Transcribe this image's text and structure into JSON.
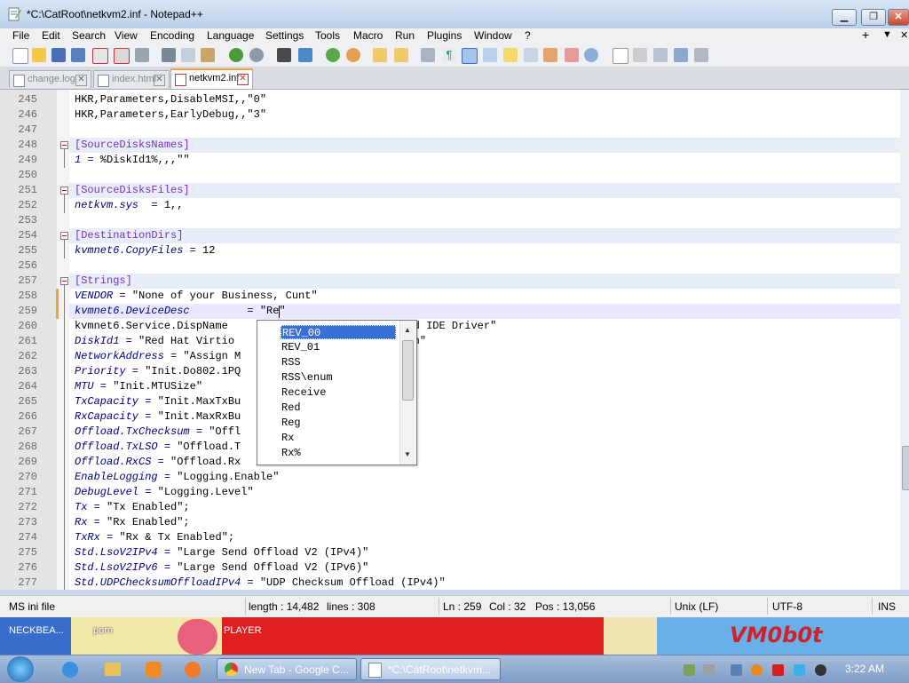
{
  "window": {
    "title": "*C:\\CatRoot\\netkvm2.inf - Notepad++",
    "min_label": "▁",
    "max_label": "❐",
    "close_label": "✕"
  },
  "menu": {
    "items": [
      "File",
      "Edit",
      "Search",
      "View",
      "Encoding",
      "Language",
      "Settings",
      "Tools",
      "Macro",
      "Run",
      "Plugins",
      "Window",
      "?"
    ],
    "right": [
      "+",
      "▼",
      "✕"
    ]
  },
  "tabs": [
    {
      "label": "change.log",
      "active": false
    },
    {
      "label": "index.html",
      "active": false
    },
    {
      "label": "netkvm2.inf",
      "active": true
    }
  ],
  "editor": {
    "lines": [
      {
        "n": "245",
        "text": "HKR,Parameters,DisableMSI,,\"0\""
      },
      {
        "n": "246",
        "text": "HKR,Parameters,EarlyDebug,,\"3\""
      },
      {
        "n": "247",
        "text": ""
      },
      {
        "n": "248",
        "text": "[SourceDisksNames]"
      },
      {
        "n": "249",
        "text": "1 = %DiskId1%,,,\"\""
      },
      {
        "n": "250",
        "text": ""
      },
      {
        "n": "251",
        "text": "[SourceDisksFiles]"
      },
      {
        "n": "252",
        "text": "netkvm.sys  = 1,,"
      },
      {
        "n": "253",
        "text": ""
      },
      {
        "n": "254",
        "text": "[DestinationDirs]"
      },
      {
        "n": "255",
        "text": "kvmnet6.CopyFiles = 12"
      },
      {
        "n": "256",
        "text": ""
      },
      {
        "n": "257",
        "text": "[Strings]"
      },
      {
        "n": "258",
        "text": "VENDOR = \"None of your Business, Cunt\""
      },
      {
        "n": "259",
        "text": "kvmnet6.DeviceDesc         = \"Re\""
      },
      {
        "n": "260",
        "text": "kvmnet6.Service.DispName                        tended IDE Driver\""
      },
      {
        "n": "261",
        "text": "DiskId1 = \"Red Hat Virtio                      mba Wan\""
      },
      {
        "n": "262",
        "text": "NetworkAddress = \"Assign M"
      },
      {
        "n": "263",
        "text": "Priority = \"Init.Do802.1PQ"
      },
      {
        "n": "264",
        "text": "MTU = \"Init.MTUSize\""
      },
      {
        "n": "265",
        "text": "TxCapacity = \"Init.MaxTxBu"
      },
      {
        "n": "266",
        "text": "RxCapacity = \"Init.MaxRxBu"
      },
      {
        "n": "267",
        "text": "Offload.TxChecksum = \"Offl"
      },
      {
        "n": "268",
        "text": "Offload.TxLSO = \"Offload.T"
      },
      {
        "n": "269",
        "text": "Offload.RxCS = \"Offload.Rx"
      },
      {
        "n": "270",
        "text": "EnableLogging = \"Logging.Enable\""
      },
      {
        "n": "271",
        "text": "DebugLevel = \"Logging.Level\""
      },
      {
        "n": "272",
        "text": "Tx = \"Tx Enabled\";"
      },
      {
        "n": "273",
        "text": "Rx = \"Rx Enabled\";"
      },
      {
        "n": "274",
        "text": "TxRx = \"Rx & Tx Enabled\";"
      },
      {
        "n": "275",
        "text": "Std.LsoV2IPv4 = \"Large Send Offload V2 (IPv4)\""
      },
      {
        "n": "276",
        "text": "Std.LsoV2IPv6 = \"Large Send Offload V2 (IPv6)\""
      },
      {
        "n": "277",
        "text": "Std.UDPChecksumOffloadIPv4 = \"UDP Checksum Offload (IPv4)\""
      }
    ]
  },
  "autocomplete": {
    "items": [
      "REV_00",
      "REV_01",
      "RSS",
      "RSS\\enum",
      "Receive",
      "Red",
      "Reg",
      "Rx",
      "Rx%"
    ],
    "selected": "REV_00"
  },
  "status": {
    "type": "MS ini file",
    "length": "length : 14,482",
    "lines": "lines : 308",
    "ln": "Ln : 259",
    "col": "Col : 32",
    "pos": "Pos : 13,056",
    "eol": "Unix (LF)",
    "encoding": "UTF-8",
    "mode": "INS"
  },
  "desktop": {
    "labels": [
      "NECKBEA...",
      "porn",
      "PLAYER",
      "VM0b0t"
    ]
  },
  "taskbar": {
    "buttons": [
      {
        "label": "New Tab - Google C...",
        "active": false
      },
      {
        "label": "*C:\\CatRoot\\netkvm...",
        "active": true
      }
    ],
    "clock": "3:22 AM"
  },
  "colors": {
    "accent_tab": "#f1a23c",
    "selection": "#3a6fd6",
    "section": "#7a2ec5",
    "key": "#000080"
  }
}
